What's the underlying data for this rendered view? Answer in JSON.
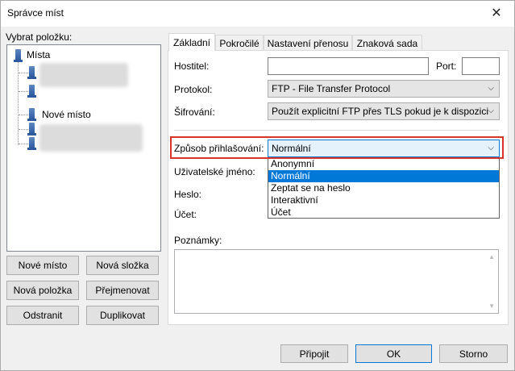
{
  "window": {
    "title": "Správce míst",
    "close_glyph": "✕"
  },
  "left": {
    "label": "Vybrat položku:",
    "tree": {
      "root_label": "Místa",
      "items": [
        {
          "label": ""
        },
        {
          "label": ""
        },
        {
          "label": "Nové místo"
        },
        {
          "label": ""
        }
      ]
    },
    "buttons": {
      "new_site": "Nové místo",
      "new_folder": "Nová složka",
      "new_item": "Nová položka",
      "rename": "Přejmenovat",
      "delete": "Odstranit",
      "duplicate": "Duplikovat"
    }
  },
  "tabs": [
    "Základní",
    "Pokročilé",
    "Nastavení přenosu",
    "Znaková sada"
  ],
  "form": {
    "host_label": "Hostitel:",
    "host_value": "",
    "port_label": "Port:",
    "port_value": "",
    "protocol_label": "Protokol:",
    "protocol_value": "FTP - File Transfer Protocol",
    "encryption_label": "Šifrování:",
    "encryption_value": "Použít explicitní FTP přes TLS pokud je k dispozici",
    "logon_label": "Způsob přihlašování:",
    "logon_value": "Normální",
    "logon_options": [
      "Anonymní",
      "Normální",
      "Zeptat se na heslo",
      "Interaktivní",
      "Účet"
    ],
    "logon_selected_index": 1,
    "user_label": "Uživatelské jméno:",
    "password_label": "Heslo:",
    "account_label": "Účet:",
    "notes_label": "Poznámky:"
  },
  "footer": {
    "connect": "Připojit",
    "ok": "OK",
    "cancel": "Storno"
  },
  "colors": {
    "highlight": "#d9342b",
    "selection": "#0078d7"
  },
  "icons": {
    "tree_root": "server-folder-icon",
    "tree_item": "server-icon",
    "dropdown": "chevron-down-icon"
  }
}
